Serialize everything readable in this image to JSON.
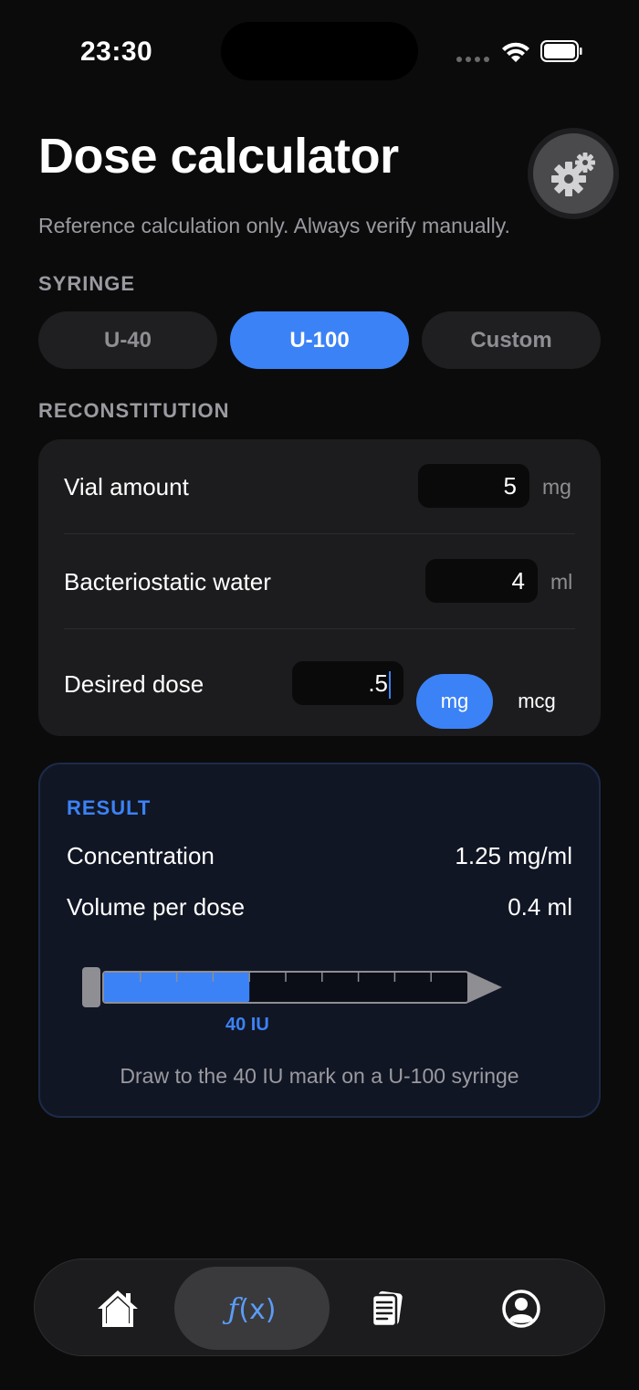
{
  "status": {
    "time": "23:30"
  },
  "header": {
    "title": "Dose calculator",
    "subtitle": "Reference calculation only. Always verify manually.",
    "settings_icon": "gear-icon"
  },
  "syringe": {
    "section_label": "SYRINGE",
    "options": [
      "U-40",
      "U-100",
      "Custom"
    ],
    "selected": "U-100"
  },
  "reconstitution": {
    "section_label": "RECONSTITUTION",
    "vial_amount": {
      "label": "Vial amount",
      "value": "5",
      "unit": "mg"
    },
    "water": {
      "label": "Bacteriostatic water",
      "value": "4",
      "unit": "ml"
    },
    "dose": {
      "label": "Desired dose",
      "value": ".5",
      "units": [
        "mg",
        "mcg"
      ],
      "selected_unit": "mg"
    }
  },
  "result": {
    "label": "RESULT",
    "concentration": {
      "label": "Concentration",
      "value": "1.25 mg/ml"
    },
    "volume": {
      "label": "Volume per dose",
      "value": "0.4 ml"
    },
    "syringe_fill_fraction": 0.4,
    "syringe_mark": "40 IU",
    "note": "Draw to the 40 IU mark on a U-100 syringe"
  },
  "tabbar": {
    "items": [
      {
        "icon": "home-icon"
      },
      {
        "label_f": "ƒ",
        "label_x": "(x)"
      },
      {
        "icon": "document-icon"
      },
      {
        "icon": "profile-icon"
      }
    ],
    "selected_index": 1
  },
  "colors": {
    "accent": "#3b82f6",
    "background": "#0b0b0c",
    "card": "#1c1c1e",
    "result_card": "#111624"
  }
}
